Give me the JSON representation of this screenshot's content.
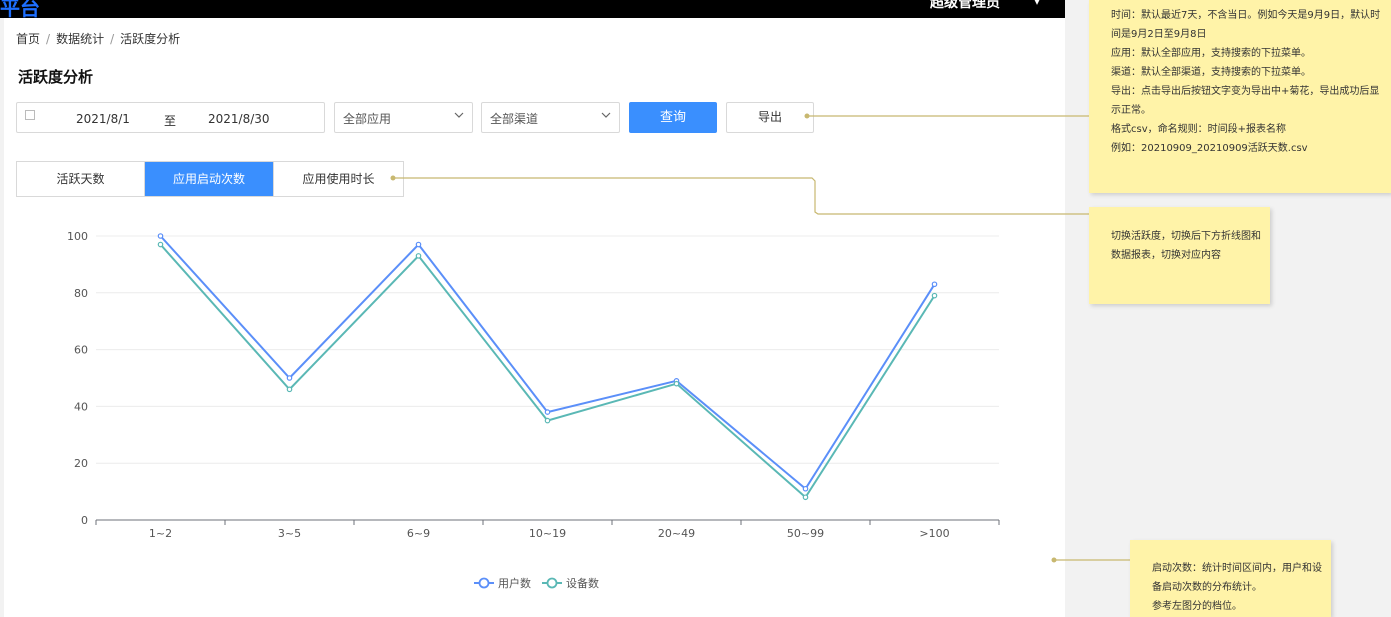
{
  "topbar": {
    "brand": "平台",
    "user": "超级管理员",
    "user_caret": "▾"
  },
  "breadcrumb": {
    "items": [
      "首页",
      "数据统计",
      "活跃度分析"
    ],
    "separator": "/"
  },
  "page_title": "活跃度分析",
  "filters": {
    "date_start": "2021/8/1",
    "date_to": "至",
    "date_end": "2021/8/30",
    "app_select": "全部应用",
    "channel_select": "全部渠道",
    "query_label": "查询",
    "export_label": "导出"
  },
  "tabs": [
    {
      "label": "活跃天数",
      "active": false
    },
    {
      "label": "应用启动次数",
      "active": true
    },
    {
      "label": "应用使用时长",
      "active": false
    }
  ],
  "chart_data": {
    "type": "line",
    "categories": [
      "1~2",
      "3~5",
      "6~9",
      "10~19",
      "20~49",
      "50~99",
      ">100"
    ],
    "series": [
      {
        "name": "用户数",
        "color": "#5b8ff9",
        "values": [
          100,
          50,
          97,
          38,
          49,
          11,
          83
        ]
      },
      {
        "name": "设备数",
        "color": "#5ab8b5",
        "values": [
          97,
          46,
          93,
          35,
          48,
          8,
          79
        ]
      }
    ],
    "yticks": [
      0,
      20,
      40,
      60,
      80,
      100
    ],
    "ylim": [
      0,
      100
    ],
    "grid": true,
    "legend": "bottom-center"
  },
  "notes": {
    "note1": [
      "时间：默认最近7天，不含当日。例如今天是9月9日，默认时间是9月2日至9月8日",
      "应用：默认全部应用，支持搜索的下拉菜单。",
      "渠道：默认全部渠道，支持搜索的下拉菜单。",
      "导出：点击导出后按钮文字变为导出中+菊花，导出成功后显示正常。",
      "格式csv，命名规则：时间段+报表名称",
      "例如：20210909_20210909活跃天数.csv"
    ],
    "note2": [
      "切换活跃度，切换后下方折线图和数据报表，切换对应内容"
    ],
    "note3": [
      "启动次数：统计时间区间内，用户和设备启动次数的分布统计。",
      "参考左图分的档位。"
    ]
  }
}
